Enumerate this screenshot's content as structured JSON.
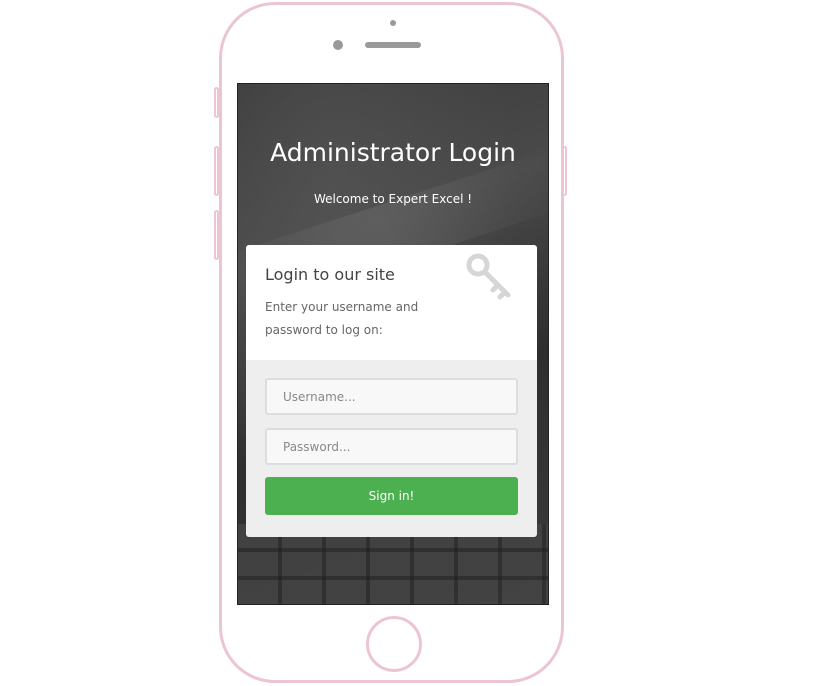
{
  "header": {
    "title": "Administrator Login",
    "subtitle": "Welcome to Expert Excel !"
  },
  "login_card": {
    "heading": "Login to our site",
    "description": "Enter your username and password to log on:",
    "icon": "key-icon"
  },
  "form": {
    "username": {
      "value": "",
      "placeholder": "Username..."
    },
    "password": {
      "value": "",
      "placeholder": "Password..."
    },
    "submit_label": "Sign in!"
  },
  "colors": {
    "frame": "#ecc5d3",
    "button": "#4caf50",
    "screen_bg": "#3a3a3a"
  }
}
